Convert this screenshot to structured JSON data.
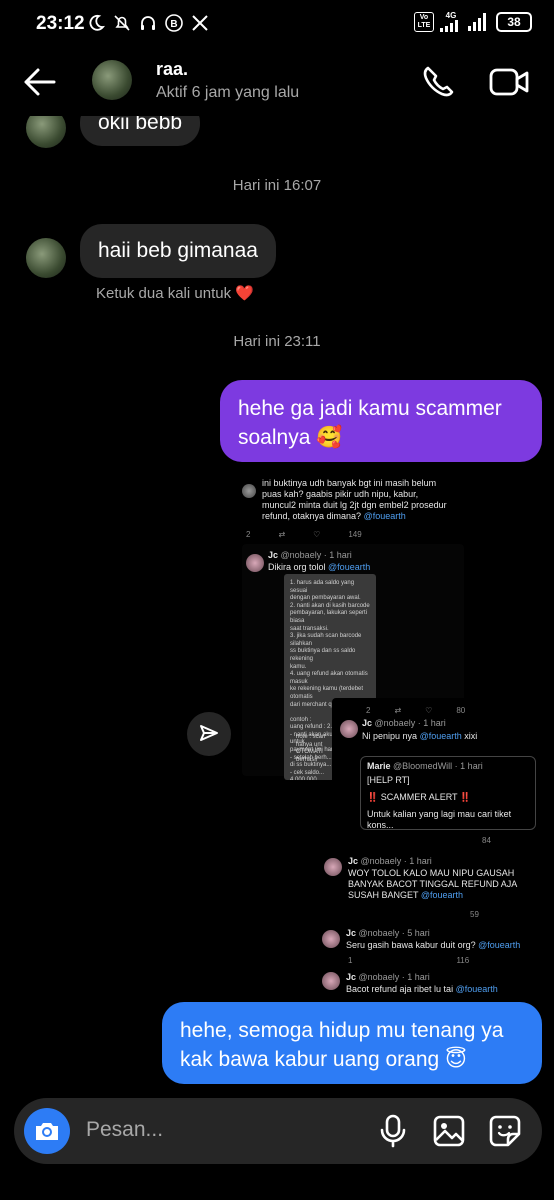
{
  "status_bar": {
    "time": "23:12",
    "network": "4G",
    "lte": "Vo LTE",
    "battery": "38"
  },
  "header": {
    "name": "raa.",
    "status": "Aktif 6 jam yang lalu"
  },
  "messages": {
    "partial_incoming": "okii bebb",
    "timestamp_1": "Hari ini 16:07",
    "incoming_1": "haii beb gimanaa",
    "hint": "Ketuk dua kali untuk ❤️",
    "timestamp_2": "Hari ini 23:11",
    "outgoing_1_line1": "hehe ga jadi kamu scammer",
    "outgoing_1_line2": "soalnya 🥰",
    "outgoing_2_line1": "hehe, semoga hidup mu tenang ya",
    "outgoing_2_line2": "kak bawa kabur uang orang 😇"
  },
  "shared_media": {
    "tweet_top_line1": "ini buktinya udh banyak bgt ini masih belum",
    "tweet_top_line2": "puas kah? gaabis pikir udh nipu, kabur,",
    "tweet_top_line3": "muncul2 minta duit lg 2jt dgn embel2 prosedur",
    "tweet_top_line4": "refund, otaknya dimana?",
    "tweet_top_mention": "@fouearth",
    "tweet_top_stats": [
      "2",
      "149"
    ],
    "tweet2_name": "Jc",
    "tweet2_handle": "@nobaely · 1 hari",
    "tweet2_text": "Dikira org tolol",
    "tweet2_mention": "@fouearth",
    "paper_lines": [
      "1. harus ada saldo yang sesuai",
      "dengan pembayaran awal.",
      "2. nanti akan di kasih barcode",
      "pembayaran, lakukan seperti biasa",
      "saat transaksi.",
      "3. jika sudah scan barcode silahkan",
      "ss buktinya dan ss saldo rekening",
      "kamu.",
      "4. uang refund akan otomatis masuk",
      "ke rekening kamu (terdebet otomatis",
      "dari merchant qris.",
      "",
      "contoh :",
      "uang refund : 2.000.000",
      "- nanti akan aku kasih qris untuk",
      "payment (ini harus ...",
      "- setelah berh...",
      "di ss buktinya...",
      "- cek saldo...",
      "4.000.000"
    ],
    "paper_note": [
      "note : scan",
      "hanya unt",
      "OTOMATI",
      "berhasil"
    ],
    "tweet3_name": "Jc",
    "tweet3_handle": "@nobaely · 1 hari",
    "tweet3_text": "Ni penipu nya",
    "tweet3_mention": "@fouearth",
    "tweet3_suffix": "xixi",
    "tweet3_stats": [
      "2",
      "80"
    ],
    "quote_name": "Marie",
    "quote_handle": "@BloomedWill · 1 hari",
    "quote_line1": "[HELP RT]",
    "quote_line2": "‼️ SCAMMER ALERT ‼️",
    "quote_line3": "Untuk kalian yang lagi mau cari tiket kons...",
    "quote_stats": "84",
    "tweet4_name": "Jc",
    "tweet4_handle": "@nobaely · 1 hari",
    "tweet4_line1": "WOY TOLOL KALO MAU NIPU GAUSAH",
    "tweet4_line2": "BANYAK BACOT TINGGAL REFUND AJA",
    "tweet4_line3": "SUSAH BANGET",
    "tweet4_mention": "@fouearth",
    "tweet4_stats": "59",
    "tweet5_name": "Jc",
    "tweet5_handle": "@nobaely · 5 hari",
    "tweet5_text": "Seru gasih bawa kabur duit org?",
    "tweet5_mention": "@fouearth",
    "tweet5_stats": [
      "1",
      "116"
    ],
    "tweet6_name": "Jc",
    "tweet6_handle": "@nobaely · 1 hari",
    "tweet6_text": "Bacot refund aja ribet lu tai",
    "tweet6_mention": "@fouearth"
  },
  "composer": {
    "placeholder": "Pesan..."
  },
  "colors": {
    "purple_bubble": "#7d3ae0",
    "blue_bubble": "#2d7cf5",
    "incoming_bubble": "#262626"
  }
}
